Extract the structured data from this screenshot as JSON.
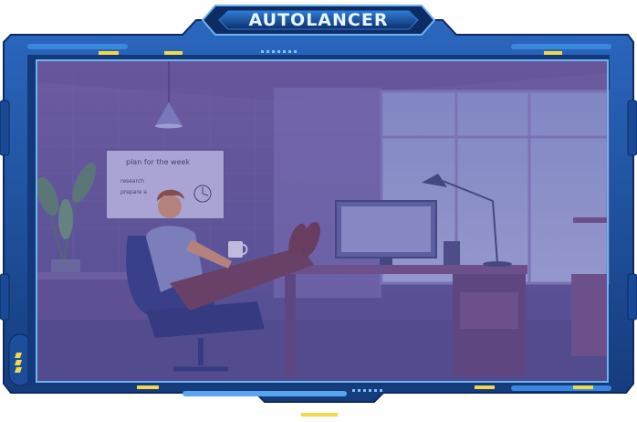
{
  "title": "AUTOLANCER",
  "whiteboard": {
    "heading": "plan for the week",
    "lines": [
      "research",
      "prepare a"
    ]
  },
  "colors": {
    "frame_dark": "#123a7a",
    "frame_mid": "#1f5fb4",
    "frame_light": "#5aa6ee",
    "accent_yellow": "#f2d94a",
    "overlay_purple": "#6a5fae"
  },
  "icons": [
    "ceiling-lamp-icon",
    "desk-lamp-icon",
    "monitor-icon",
    "plant-icon",
    "mug-icon",
    "chair-icon",
    "clock-icon",
    "stripes-icon"
  ]
}
